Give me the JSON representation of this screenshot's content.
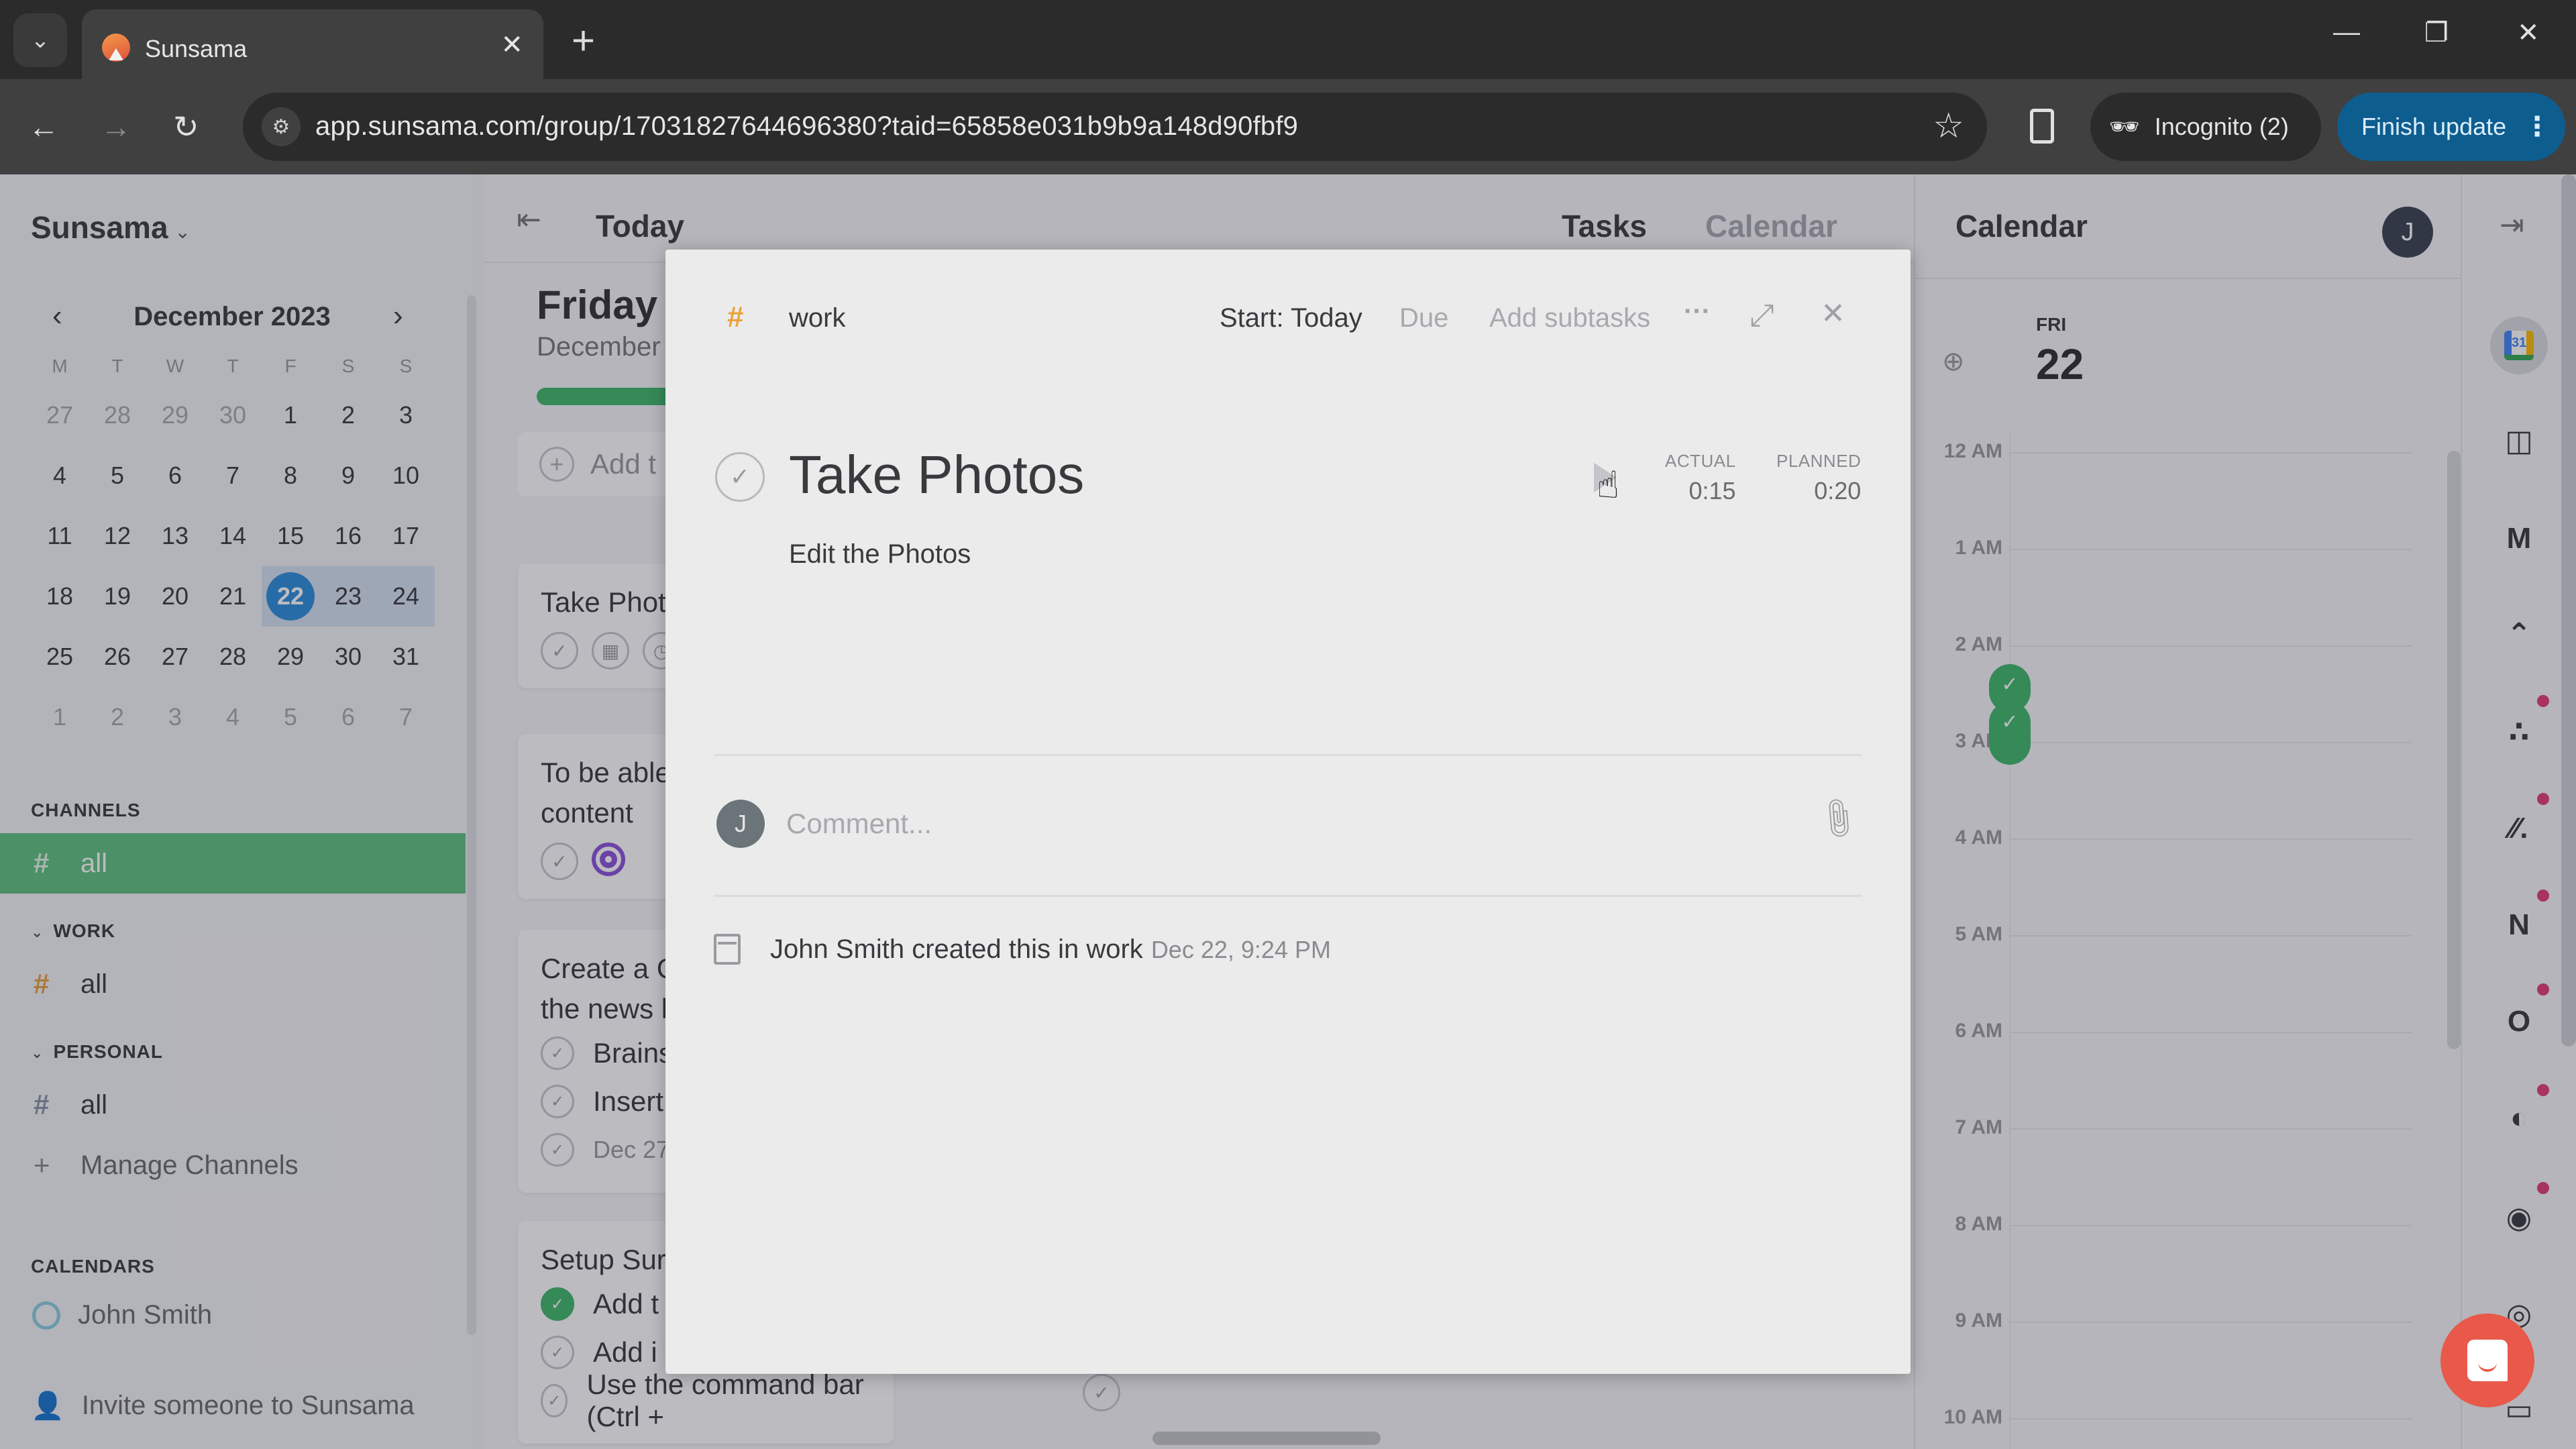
{
  "browser": {
    "tab_title": "Sunsama",
    "url": "app.sunsama.com/group/17031827644696380?taid=65858e031b9b9a148d90fbf9",
    "incognito_label": "Incognito (2)",
    "finish_update_label": "Finish update"
  },
  "sidebar": {
    "brand": "Sunsama",
    "mini_calendar": {
      "month_label": "December 2023",
      "weekdays": [
        "M",
        "T",
        "W",
        "T",
        "F",
        "S",
        "S"
      ],
      "weeks": [
        [
          {
            "d": "27",
            "muted": true
          },
          {
            "d": "28",
            "muted": true
          },
          {
            "d": "29",
            "muted": true
          },
          {
            "d": "30",
            "muted": true
          },
          {
            "d": "1"
          },
          {
            "d": "2"
          },
          {
            "d": "3"
          }
        ],
        [
          {
            "d": "4"
          },
          {
            "d": "5"
          },
          {
            "d": "6"
          },
          {
            "d": "7"
          },
          {
            "d": "8"
          },
          {
            "d": "9"
          },
          {
            "d": "10"
          }
        ],
        [
          {
            "d": "11"
          },
          {
            "d": "12"
          },
          {
            "d": "13"
          },
          {
            "d": "14"
          },
          {
            "d": "15"
          },
          {
            "d": "16"
          },
          {
            "d": "17"
          }
        ],
        [
          {
            "d": "18"
          },
          {
            "d": "19"
          },
          {
            "d": "20"
          },
          {
            "d": "21"
          },
          {
            "d": "22",
            "selected": true,
            "hl": true
          },
          {
            "d": "23",
            "hl": true
          },
          {
            "d": "24",
            "hl": true
          }
        ],
        [
          {
            "d": "25"
          },
          {
            "d": "26"
          },
          {
            "d": "27"
          },
          {
            "d": "28"
          },
          {
            "d": "29"
          },
          {
            "d": "30"
          },
          {
            "d": "31"
          }
        ],
        [
          {
            "d": "1",
            "muted": true
          },
          {
            "d": "2",
            "muted": true
          },
          {
            "d": "3",
            "muted": true
          },
          {
            "d": "4",
            "muted": true
          },
          {
            "d": "5",
            "muted": true
          },
          {
            "d": "6",
            "muted": true
          },
          {
            "d": "7",
            "muted": true
          }
        ]
      ]
    },
    "channels_label": "CHANNELS",
    "channels_all": "all",
    "work_label": "WORK",
    "work_all": "all",
    "personal_label": "PERSONAL",
    "personal_all": "all",
    "manage_channels": "Manage Channels",
    "calendars_label": "CALENDARS",
    "calendar_person": "John Smith",
    "invite": "Invite someone to Sunsama",
    "colors": {
      "active_channel": "#5fc27e",
      "work_hash": "#e9a23b",
      "selected_day": "#2d8fdc"
    }
  },
  "middle": {
    "title": "Today",
    "tab_tasks": "Tasks",
    "tab_calendar": "Calendar",
    "day_name": "Friday",
    "day_date": "December",
    "progress_fraction": 0.78,
    "add_task": "Add t",
    "cards": [
      {
        "title": "Take Phot"
      },
      {
        "title_line1": "To be able",
        "title_line2": "content"
      },
      {
        "title_line1": "Create a C",
        "title_line2": "the news l",
        "subtasks": [
          "Brains",
          "Insert"
        ],
        "date": "Dec 27"
      },
      {
        "title": "Setup Sur",
        "subtasks": [
          {
            "label": "Add t",
            "done": true
          },
          {
            "label": "Add i",
            "done": false
          },
          {
            "label": "Use the command bar (Ctrl +",
            "done": false
          }
        ]
      }
    ]
  },
  "right_calendar": {
    "title": "Calendar",
    "avatar_initial": "J",
    "day_of_week": "FRI",
    "day_number": "22",
    "hours": [
      "12 AM",
      "1 AM",
      "2 AM",
      "3 AM",
      "4 AM",
      "5 AM",
      "6 AM",
      "7 AM",
      "8 AM",
      "9 AM",
      "10 AM"
    ]
  },
  "rail": {
    "icons": [
      "google-calendar-icon",
      "trello-icon",
      "gmail-icon",
      "clickup-icon",
      "asana-icon",
      "monday-icon",
      "notion-icon",
      "outlook-icon",
      "linear-icon",
      "github-icon",
      "target-icon",
      "archive-icon"
    ]
  },
  "modal": {
    "channel": "work",
    "start_label": "Start: Today",
    "due_label": "Due",
    "subtasks_label": "Add subtasks",
    "more_label": "···",
    "title": "Take Photos",
    "notes": "Edit the Photos",
    "actual_label": "ACTUAL",
    "actual_value": "0:15",
    "planned_label": "PLANNED",
    "planned_value": "0:20",
    "avatar_initial": "J",
    "comment_placeholder": "Comment...",
    "activity_text": "John Smith created this in work",
    "activity_time": "Dec 22, 9:24 PM"
  }
}
